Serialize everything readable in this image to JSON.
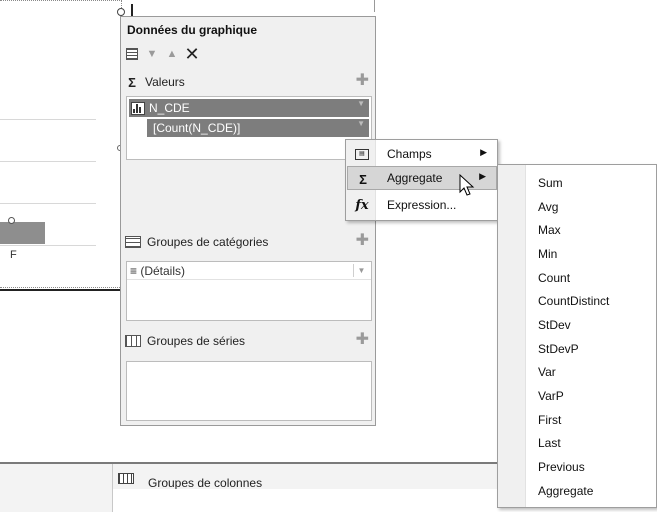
{
  "chart": {
    "axis_tick": "F"
  },
  "data_panel": {
    "title": "Données du graphique",
    "values_section": {
      "label": "Valeurs",
      "items": [
        {
          "label": "N_CDE"
        },
        {
          "label": "[Count(N_CDE)]"
        }
      ]
    },
    "categories_section": {
      "label": "Groupes de catégories",
      "items": [
        {
          "label": "≡ (Détails)"
        }
      ]
    },
    "series_section": {
      "label": "Groupes de séries"
    }
  },
  "bottom_panel": {
    "column_groups_label": "Groupes de colonnes"
  },
  "context_menu": {
    "items": [
      {
        "label": "Champs",
        "icon": "fields-icon",
        "has_submenu": true
      },
      {
        "label": "Aggregate",
        "icon": "sigma-icon",
        "has_submenu": true,
        "highlighted": true
      },
      {
        "label": "Expression...",
        "icon": "fx-icon",
        "has_submenu": false
      }
    ]
  },
  "aggregate_submenu": {
    "items": [
      "Sum",
      "Avg",
      "Max",
      "Min",
      "Count",
      "CountDistinct",
      "StDev",
      "StDevP",
      "Var",
      "VarP",
      "First",
      "Last",
      "Previous",
      "Aggregate"
    ]
  },
  "colors": {
    "panel_bg": "#f0f0f0",
    "value_row_bg": "#7d7d7d",
    "menu_highlight": "#d6d6d6",
    "chart_bar": "#8e8e8e"
  }
}
